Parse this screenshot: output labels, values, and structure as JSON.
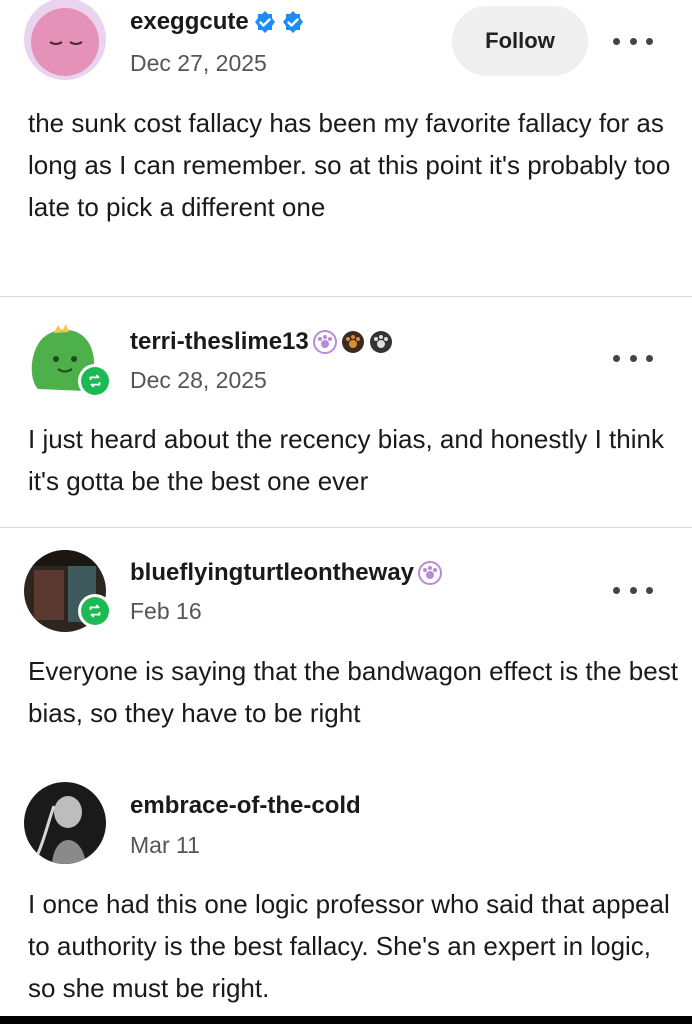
{
  "posts": [
    {
      "username": "exeggcute",
      "date": "Dec 27, 2025",
      "follow_label": "Follow",
      "text": "the sunk cost fallacy has been my favorite fallacy for as long as I can remember. so at this point it's probably too late to pick a different one"
    },
    {
      "username": "terri-theslime13",
      "date": "Dec 28, 2025",
      "text": "I just heard about the recency bias, and honestly I think it's gotta be the best one ever"
    },
    {
      "username": "blueflyingturtleontheway",
      "date": "Feb 16",
      "text": "Everyone is saying that the bandwagon effect is the best bias, so they have to be right"
    },
    {
      "username": "embrace-of-the-cold",
      "date": "Mar 11",
      "text": "I once had this one logic professor who said that appeal to authority is the best fallacy. She's an expert in logic, so she must be right."
    }
  ],
  "icons": {
    "verified": "verified-badge-icon",
    "paw": "paw-badge-icon",
    "repost": "repost-icon",
    "more": "more-options-icon"
  },
  "colors": {
    "verified_blue": "#1d8cf8",
    "repost_green": "#1db954",
    "paw_purple": "#b88ad9",
    "paw_orange": "#e08a3c",
    "paw_gray": "#777777"
  }
}
